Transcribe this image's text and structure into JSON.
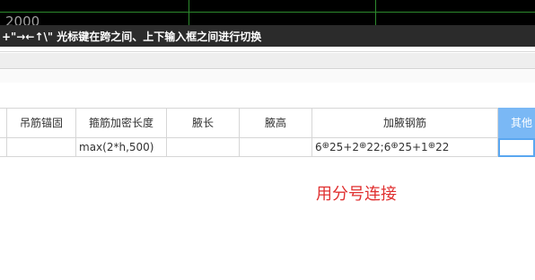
{
  "cad_view": {
    "dimension_text": "2000"
  },
  "hint_bar": {
    "text": "+\"→←↑\\\" 光标键在跨之间、上下输入框之间进行切换"
  },
  "table": {
    "headers": [
      "吊筋锚固",
      "箍筋加密长度",
      "腋长",
      "腋高",
      "加腋钢筋",
      "其他"
    ],
    "row": {
      "hanger_anchor": "",
      "stirrup_dense_length": "max(2*h,500)",
      "haunch_length": "",
      "haunch_height": "",
      "haunch_rebar": [
        "6",
        "25+2",
        "22;6",
        "25+1",
        "22"
      ],
      "other": ""
    },
    "rebar_symbol": "⊕",
    "active_header_color": "#7ab8f5"
  },
  "annotation": {
    "text": "用分号连接",
    "color": "#e03030"
  }
}
